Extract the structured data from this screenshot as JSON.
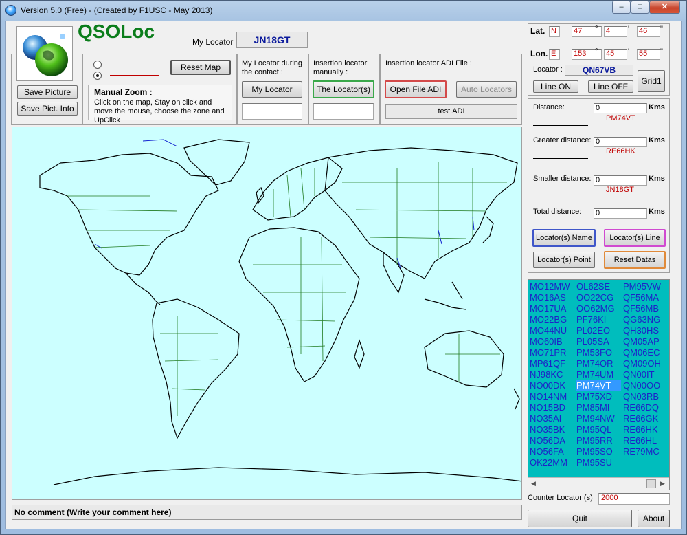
{
  "window": {
    "title": "Version 5.0 (Free) - (Created by F1USC - May 2013)",
    "min_label": "–",
    "max_label": "□",
    "close_label": "✕"
  },
  "header": {
    "app_name": "QSOLoc",
    "my_locator_label": "My Locator :",
    "my_locator_value": "JN18GT"
  },
  "left_buttons": {
    "save_picture": "Save Picture",
    "save_pict_info": "Save Pict. Info"
  },
  "zoom": {
    "reset_map": "Reset Map",
    "manual_zoom_title": "Manual Zoom :",
    "manual_zoom_text": "Click on the map, Stay on click and move the mouse, choose the zone and UpClick"
  },
  "contact": {
    "label": "My Locator during the contact :",
    "button": "My Locator",
    "input_value": ""
  },
  "insertion": {
    "label": "Insertion locator manually :",
    "button": "The Locator(s)",
    "input_value": ""
  },
  "adi": {
    "label": "Insertion locator ADI File :",
    "open_button": "Open File ADI",
    "auto_button": "Auto Locators",
    "file_value": "test.ADI"
  },
  "coords": {
    "lat_label": "Lat.",
    "lat_hemisphere": "N",
    "lat_deg": "47",
    "lat_min": "4",
    "lat_sec": "46",
    "lon_label": "Lon.",
    "lon_hemisphere": "E",
    "lon_deg": "153",
    "lon_min": "45",
    "lon_sec": "55",
    "deg_mark": "°",
    "min_mark": "'",
    "sec_mark": "\"",
    "locator_label": "Locator :",
    "locator_value": "QN67VB",
    "line_on": "Line ON",
    "line_off": "Line OFF",
    "grid": "Grid1"
  },
  "distances": {
    "distance_label": "Distance:",
    "distance_value": "0",
    "distance_loc": "PM74VT",
    "greater_label": "Greater distance:",
    "greater_value": "0",
    "greater_loc": "RE66HK",
    "smaller_label": "Smaller distance:",
    "smaller_value": "0",
    "smaller_loc": "JN18GT",
    "total_label": "Total distance:",
    "total_value": "0",
    "unit": "Kms"
  },
  "locator_buttons": {
    "name": "Locator(s) Name",
    "line": "Locator(s) Line",
    "point": "Locator(s) Point",
    "reset": "Reset Datas"
  },
  "locator_list": {
    "selected": "PM74VT",
    "col1": [
      "MO12MW",
      "MO16AS",
      "MO17UA",
      "MO22BG",
      "MO44NU",
      "MO60IB",
      "MO71PR",
      "MP61QF",
      "NJ98KC",
      "NO00DK",
      "NO14NM",
      "NO15BD",
      "NO35AI",
      "NO35BK",
      "NO56DA",
      "NO56FA",
      "OK22MM"
    ],
    "col2": [
      "OL62SE",
      "OO22CG",
      "OO62MG",
      "PF76KI",
      "PL02EO",
      "PL05SA",
      "PM53FO",
      "PM74OR",
      "PM74UM",
      "PM74VT",
      "PM75XD",
      "PM85MI",
      "PM94NW",
      "PM95QL",
      "PM95RR",
      "PM95SO",
      "PM95SU"
    ],
    "col3": [
      "PM95VW",
      "QF56MA",
      "QF56MB",
      "QG63NG",
      "QH30HS",
      "QM05AP",
      "QM06EC",
      "QM09OH",
      "QN00IT",
      "QN00OO",
      "QN03RB",
      "RE66DQ",
      "RE66GK",
      "RE66HK",
      "RE66HL",
      "RE79MC"
    ]
  },
  "counter": {
    "label": "Counter Locator (s)",
    "value": "2000"
  },
  "comment": {
    "text": "No comment (Write your comment here)"
  },
  "footer": {
    "quit": "Quit",
    "about": "About"
  },
  "colors": {
    "map_sea": "#ccffff",
    "list_bg": "#00bdbd",
    "app_name": "#0b7d1b"
  }
}
